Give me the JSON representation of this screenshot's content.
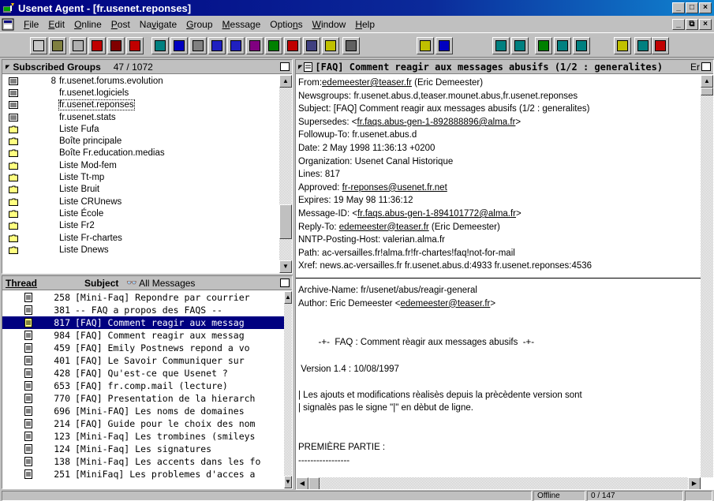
{
  "window": {
    "title": "Usenet Agent - [fr.usenet.reponses]"
  },
  "menu": [
    {
      "label": "File",
      "key": "F",
      "rest": "ile"
    },
    {
      "label": "Edit",
      "key": "E",
      "rest": "dit"
    },
    {
      "label": "Online",
      "key": "O",
      "rest": "nline"
    },
    {
      "label": "Post",
      "key": "P",
      "rest": "ost"
    },
    {
      "label": "Navigate",
      "pre": "Na",
      "key": "v",
      "rest": "igate"
    },
    {
      "label": "Group",
      "key": "G",
      "rest": "roup"
    },
    {
      "label": "Message",
      "key": "M",
      "rest": "essage"
    },
    {
      "label": "Options",
      "pre": "Optio",
      "key": "n",
      "rest": "s"
    },
    {
      "label": "Window",
      "key": "W",
      "rest": "indow"
    },
    {
      "label": "Help",
      "key": "H",
      "rest": "elp"
    }
  ],
  "groups": {
    "title": "Subscribed Groups",
    "count": "47 / 1072",
    "items": [
      {
        "num": "8",
        "name": "fr.usenet.forums.evolution",
        "icon": "newsgroup-icon"
      },
      {
        "num": "",
        "name": "fr.usenet.logiciels",
        "icon": "newsgroup-icon"
      },
      {
        "num": "",
        "name": "fr.usenet.reponses",
        "icon": "newsgroup-icon",
        "selected": true
      },
      {
        "num": "",
        "name": "fr.usenet.stats",
        "icon": "newsgroup-icon"
      },
      {
        "num": "",
        "name": "Liste Fufa",
        "icon": "folder-icon"
      },
      {
        "num": "",
        "name": "Boîte principale",
        "icon": "folder-icon"
      },
      {
        "num": "",
        "name": "Boîte Fr.education.medias",
        "icon": "folder-icon"
      },
      {
        "num": "",
        "name": "Liste Mod-fem",
        "icon": "folder-icon"
      },
      {
        "num": "",
        "name": "Liste Tt-mp",
        "icon": "folder-icon"
      },
      {
        "num": "",
        "name": "Liste Bruit",
        "icon": "folder-icon"
      },
      {
        "num": "",
        "name": "Liste CRUnews",
        "icon": "folder-icon"
      },
      {
        "num": "",
        "name": "Liste École",
        "icon": "folder-icon"
      },
      {
        "num": "",
        "name": "Liste Fr2",
        "icon": "folder-icon"
      },
      {
        "num": "",
        "name": "Liste Fr-chartes",
        "icon": "folder-icon"
      },
      {
        "num": "",
        "name": "Liste Dnews",
        "icon": "folder-icon"
      }
    ]
  },
  "threads": {
    "col_thread": "Thread",
    "col_subject": "Subject",
    "filter": "All Messages",
    "items": [
      {
        "num": "258",
        "subject": "[Mini-Faq] Repondre par courrier"
      },
      {
        "num": "381",
        "subject": "-- FAQ a propos des FAQS --"
      },
      {
        "num": "817",
        "subject": "[FAQ] Comment reagir aux messag",
        "selected": true
      },
      {
        "num": "984",
        "subject": "[FAQ] Comment reagir aux messag"
      },
      {
        "num": "459",
        "subject": "[FAQ] Emily Postnews repond a vo"
      },
      {
        "num": "401",
        "subject": "[FAQ] Le Savoir Communiquer sur"
      },
      {
        "num": "428",
        "subject": "[FAQ] Qu'est-ce que Usenet ?"
      },
      {
        "num": "653",
        "subject": "[FAQ] fr.comp.mail (lecture)"
      },
      {
        "num": "770",
        "subject": "[FAQ] Presentation de la hierarch"
      },
      {
        "num": "696",
        "subject": "[Mini-FAQ] Les noms de domaines"
      },
      {
        "num": "214",
        "subject": "[FAQ] Guide pour le choix des nom"
      },
      {
        "num": "123",
        "subject": "[Mini-Faq] Les trombines (smileys"
      },
      {
        "num": "124",
        "subject": "[Mini-Faq] Les signatures"
      },
      {
        "num": "138",
        "subject": "[Mini-Faq] Les accents dans les fo"
      },
      {
        "num": "251",
        "subject": "[MiniFaq] Les problemes d'acces a"
      }
    ]
  },
  "message": {
    "title": "[FAQ] Comment reagir aux messages abusifs (1/2 : generalites)",
    "title_suffix": "Er",
    "headers": [
      {
        "label": "From:",
        "value": "",
        "link": "edemeester@teaser.fr",
        "after": " (Eric Demeester)"
      },
      {
        "label": "Newsgroups:",
        "value": " fr.usenet.abus.d,teaser.mounet.abus,fr.usenet.reponses",
        "link": "",
        "after": ""
      },
      {
        "label": "Subject:",
        "value": " [FAQ] Comment reagir aux messages abusifs (1/2 : generalites)",
        "link": "",
        "after": ""
      },
      {
        "label": "Supersedes:",
        "value": " <",
        "link": "fr.faqs.abus-gen-1-892888896@alma.fr",
        "after": ">"
      },
      {
        "label": "Followup-To:",
        "value": " fr.usenet.abus.d",
        "link": "",
        "after": ""
      },
      {
        "label": "Date:",
        "value": " 2 May 1998 11:36:13 +0200",
        "link": "",
        "after": ""
      },
      {
        "label": "Organization:",
        "value": " Usenet Canal Historique",
        "link": "",
        "after": ""
      },
      {
        "label": "Lines:",
        "value": " 817",
        "link": "",
        "after": ""
      },
      {
        "label": "Approved:",
        "value": " ",
        "link": "fr-reponses@usenet.fr.net",
        "after": ""
      },
      {
        "label": "Expires:",
        "value": " 19 May 98 11:36:12",
        "link": "",
        "after": ""
      },
      {
        "label": "Message-ID:",
        "value": " <",
        "link": "fr.faqs.abus-gen-1-894101772@alma.fr",
        "after": ">"
      },
      {
        "label": "Reply-To:",
        "value": " ",
        "link": "edemeester@teaser.fr",
        "after": " (Eric Demeester)"
      },
      {
        "label": "NNTP-Posting-Host:",
        "value": " valerian.alma.fr",
        "link": "",
        "after": ""
      },
      {
        "label": "Path:",
        "value": " ac-versailles.fr!alma.fr!fr-chartes!faq!not-for-mail",
        "link": "",
        "after": ""
      },
      {
        "label": "Xref:",
        "value": " news.ac-versailles.fr fr.usenet.abus.d:4933 fr.usenet.reponses:4536",
        "link": "",
        "after": ""
      }
    ],
    "body": [
      {
        "text": "Archive-Name: fr/usenet/abus/reagir-general",
        "link": "",
        "after": ""
      },
      {
        "text": "Author: Eric Demeester <",
        "link": "edemeester@teaser.fr",
        "after": ">"
      },
      {
        "text": "",
        "link": "",
        "after": ""
      },
      {
        "text": "",
        "link": "",
        "after": ""
      },
      {
        "text": "        -+-  FAQ : Comment rèagir aux messages abusifs  -+-",
        "link": "",
        "after": ""
      },
      {
        "text": "",
        "link": "",
        "after": ""
      },
      {
        "text": " Version 1.4 : 10/08/1997",
        "link": "",
        "after": ""
      },
      {
        "text": "",
        "link": "",
        "after": ""
      },
      {
        "text": "| Les ajouts et modifications rèalisès depuis la prècèdente version sont",
        "link": "",
        "after": ""
      },
      {
        "text": "| signalès pas le signe \"|\" en dèbut de ligne.",
        "link": "",
        "after": ""
      },
      {
        "text": "",
        "link": "",
        "after": ""
      },
      {
        "text": "",
        "link": "",
        "after": ""
      },
      {
        "text": "PREMIÈRE PARTIE :",
        "link": "",
        "after": ""
      },
      {
        "text": "-----------------",
        "link": "",
        "after": ""
      }
    ]
  },
  "status": {
    "mode": "Offline",
    "count": "0 / 147"
  }
}
